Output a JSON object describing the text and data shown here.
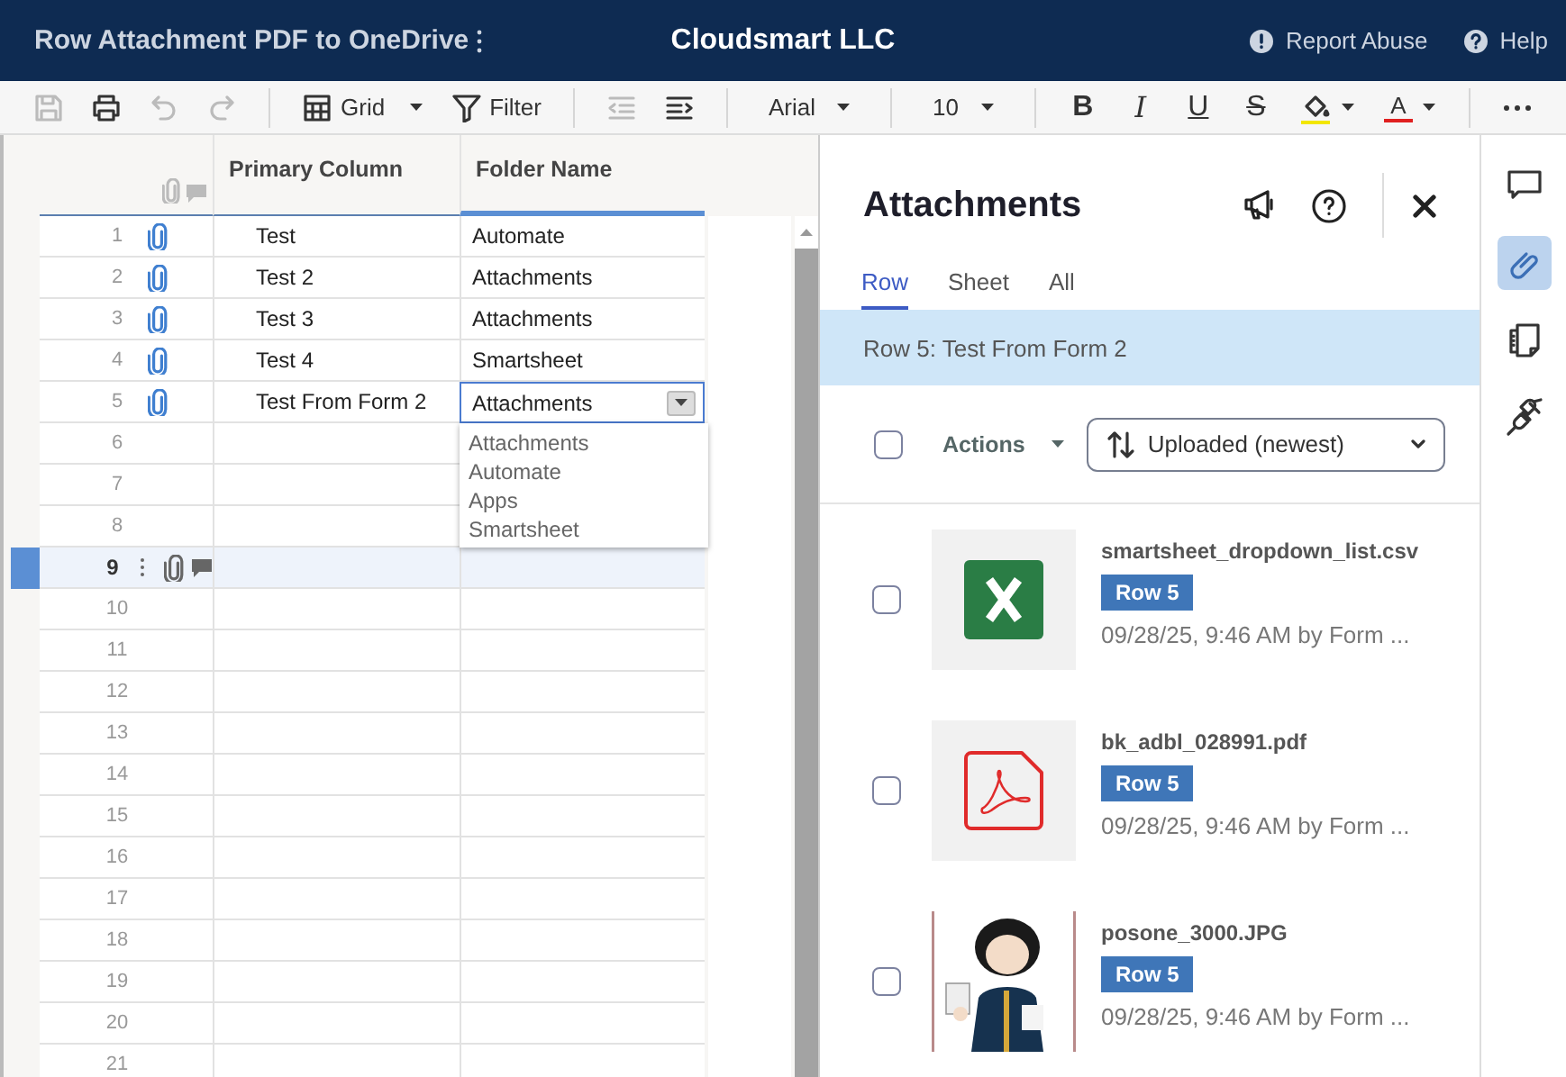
{
  "header": {
    "title": "Row Attachment PDF to OneDrive",
    "company": "Cloudsmart LLC",
    "links": [
      {
        "kind": "report",
        "label": "Report Abuse"
      },
      {
        "kind": "help",
        "label": "Help"
      }
    ]
  },
  "toolbar": {
    "save": {
      "disabled": true
    },
    "print": {
      "disabled": false
    },
    "undo": {
      "disabled": true
    },
    "redo": {
      "disabled": true
    },
    "view": {
      "label": "Grid"
    },
    "filter": {
      "label": "Filter"
    },
    "outdent": {
      "disabled": true
    },
    "indent": {
      "disabled": false
    },
    "font": {
      "label": "Arial"
    },
    "size": {
      "label": "10"
    },
    "format_buttons": [
      {
        "kind": "bold",
        "label": "B"
      },
      {
        "kind": "italic",
        "label": "I"
      },
      {
        "kind": "underline",
        "label": "U"
      },
      {
        "kind": "strikethrough",
        "label": "S"
      }
    ],
    "text_color": {
      "label": "A"
    }
  },
  "grid": {
    "columns": [
      {
        "label": "Primary Column"
      },
      {
        "label": "Folder Name"
      }
    ],
    "rows": [
      {
        "number": "1",
        "attachment": true,
        "selected": false,
        "editing": false,
        "cells": [
          "Test",
          "Automate"
        ]
      },
      {
        "number": "2",
        "attachment": true,
        "selected": false,
        "editing": false,
        "cells": [
          "Test 2",
          "Attachments"
        ]
      },
      {
        "number": "3",
        "attachment": true,
        "selected": false,
        "editing": false,
        "cells": [
          "Test 3",
          "Attachments"
        ]
      },
      {
        "number": "4",
        "attachment": true,
        "selected": false,
        "editing": false,
        "cells": [
          "Test 4",
          "Smartsheet"
        ]
      },
      {
        "number": "5",
        "attachment": true,
        "selected": false,
        "editing": true,
        "cells": [
          "Test From Form 2",
          "Attachments"
        ]
      },
      {
        "number": "6",
        "attachment": false,
        "selected": false,
        "editing": false
      },
      {
        "number": "7",
        "attachment": false,
        "selected": false,
        "editing": false
      },
      {
        "number": "8",
        "attachment": false,
        "selected": false,
        "editing": false
      },
      {
        "number": "9",
        "attachment": false,
        "selected": true,
        "editing": false
      },
      {
        "number": "10",
        "attachment": false,
        "selected": false,
        "editing": false
      },
      {
        "number": "11",
        "attachment": false,
        "selected": false,
        "editing": false
      },
      {
        "number": "12",
        "attachment": false,
        "selected": false,
        "editing": false
      },
      {
        "number": "13",
        "attachment": false,
        "selected": false,
        "editing": false
      },
      {
        "number": "14",
        "attachment": false,
        "selected": false,
        "editing": false
      },
      {
        "number": "15",
        "attachment": false,
        "selected": false,
        "editing": false
      },
      {
        "number": "16",
        "attachment": false,
        "selected": false,
        "editing": false
      },
      {
        "number": "17",
        "attachment": false,
        "selected": false,
        "editing": false
      },
      {
        "number": "18",
        "attachment": false,
        "selected": false,
        "editing": false
      },
      {
        "number": "19",
        "attachment": false,
        "selected": false,
        "editing": false
      },
      {
        "number": "20",
        "attachment": false,
        "selected": false,
        "editing": false
      },
      {
        "number": "21",
        "attachment": false,
        "selected": false,
        "editing": false
      }
    ],
    "dropdown": {
      "options": [
        "Attachments",
        "Automate",
        "Apps",
        "Smartsheet"
      ]
    }
  },
  "panel": {
    "title": "Attachments",
    "tabs": [
      {
        "label": "Row",
        "selected": true
      },
      {
        "label": "Sheet",
        "selected": false
      },
      {
        "label": "All",
        "selected": false
      }
    ],
    "context": "Row 5: Test From Form 2",
    "select_all": {
      "checked": false
    },
    "actions": "Actions",
    "sort": "Uploaded (newest)",
    "attachments": [
      {
        "kind": "spreadsheet",
        "name": "smartsheet_dropdown_list.csv",
        "tag": "Row 5",
        "meta": "09/28/25, 9:46 AM by Form ...",
        "checked": false
      },
      {
        "kind": "pdf",
        "name": "bk_adbl_028991.pdf",
        "tag": "Row 5",
        "meta": "09/28/25, 9:46 AM by Form ...",
        "checked": false
      },
      {
        "kind": "picture",
        "name": "posone_3000.JPG",
        "tag": "Row 5",
        "meta": "09/28/25, 9:46 AM by Form ...",
        "checked": false
      }
    ]
  },
  "rail": [
    {
      "kind": "comments",
      "selected": false
    },
    {
      "kind": "attachments",
      "selected": true
    },
    {
      "kind": "proofs",
      "selected": false
    },
    {
      "kind": "connections",
      "selected": false
    }
  ]
}
